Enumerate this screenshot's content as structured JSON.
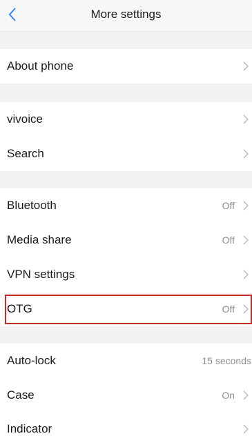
{
  "header": {
    "title": "More settings",
    "back_icon": "chevron-left-icon",
    "accent_color": "#2f8bff"
  },
  "rows": {
    "about_phone": {
      "label": "About phone",
      "value": ""
    },
    "vivoice": {
      "label": "vivoice",
      "value": ""
    },
    "search": {
      "label": "Search",
      "value": ""
    },
    "bluetooth": {
      "label": "Bluetooth",
      "value": "Off"
    },
    "media_share": {
      "label": "Media share",
      "value": "Off"
    },
    "vpn_settings": {
      "label": "VPN settings",
      "value": ""
    },
    "otg": {
      "label": "OTG",
      "value": "Off"
    },
    "auto_lock": {
      "label": "Auto-lock",
      "value": "15 seconds"
    },
    "case": {
      "label": "Case",
      "value": "On"
    },
    "indicator": {
      "label": "Indicator",
      "value": ""
    }
  },
  "highlight_color": "#c62828",
  "row_chevron_icon": "chevron-right-icon"
}
